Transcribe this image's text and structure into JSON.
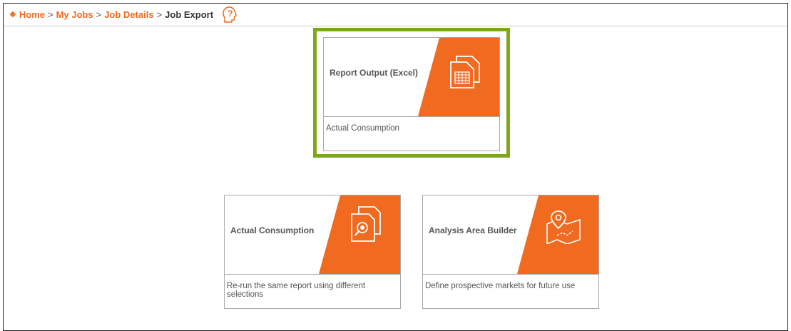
{
  "breadcrumb": {
    "home": "Home",
    "my_jobs": "My Jobs",
    "job_details": "Job Details",
    "current": "Job Export",
    "separator": ">"
  },
  "cards": [
    {
      "title": "Report Output (Excel)",
      "description": "Actual Consumption",
      "icon": "excel-document-icon"
    },
    {
      "title": "Actual Consumption",
      "description": "Re-run the same report using different selections",
      "icon": "document-search-icon"
    },
    {
      "title": "Analysis Area Builder",
      "description": "Define prospective markets for future use",
      "icon": "map-pin-icon"
    }
  ],
  "colors": {
    "accent": "#f06a1f",
    "highlight": "#7ea81c"
  }
}
